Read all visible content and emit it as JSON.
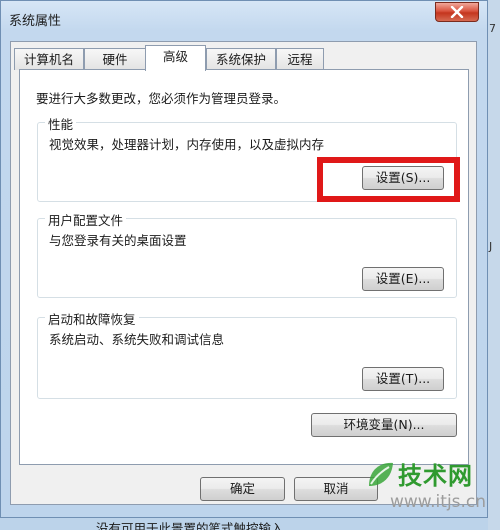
{
  "window": {
    "title": "系统属性",
    "close_icon": "close-icon"
  },
  "tabs": [
    {
      "label": "计算机名"
    },
    {
      "label": "硬件"
    },
    {
      "label": "高级",
      "active": true
    },
    {
      "label": "系统保护"
    },
    {
      "label": "远程"
    }
  ],
  "notice": "要进行大多数更改，您必须作为管理员登录。",
  "groups": {
    "performance": {
      "title": "性能",
      "desc": "视觉效果，处理器计划，内存使用，以及虚拟内存",
      "button": "设置(S)..."
    },
    "user_profiles": {
      "title": "用户配置文件",
      "desc": "与您登录有关的桌面设置",
      "button": "设置(E)..."
    },
    "startup_recovery": {
      "title": "启动和故障恢复",
      "desc": "系统启动、系统失败和调试信息",
      "button": "设置(T)..."
    }
  },
  "env_button": "环境变量(N)...",
  "footer": {
    "ok": "确定",
    "cancel": "取消"
  },
  "watermark": {
    "name": "技术网",
    "url": "www.itjs.cn"
  },
  "background_text": {
    "bottom": "没有可用于此景置的笔式触控输入",
    "right_1": "7",
    "right_2": "J"
  },
  "colors": {
    "highlight": "#e01818",
    "watermark_green": "#2f9a2f"
  }
}
